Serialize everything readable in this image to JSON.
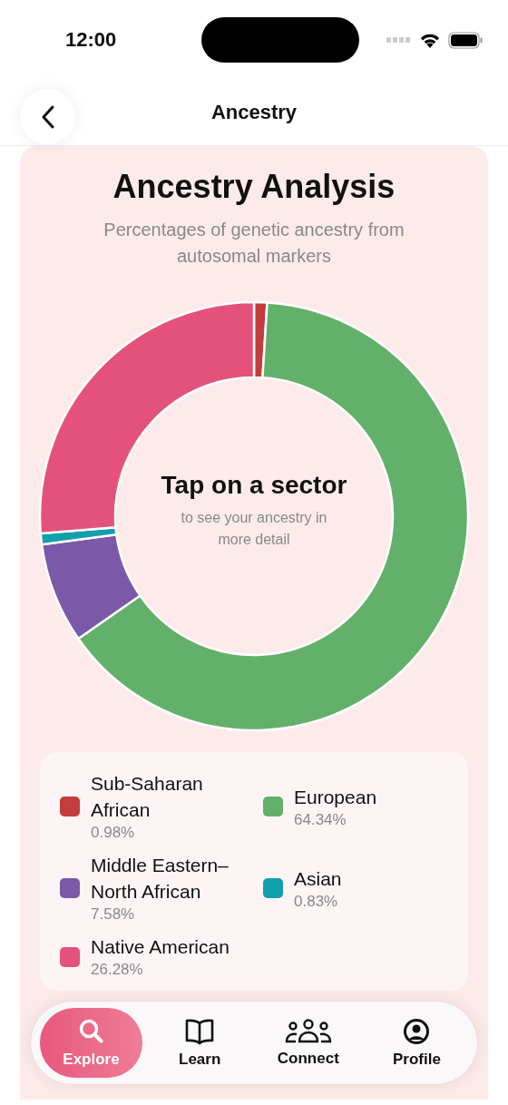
{
  "status_bar": {
    "time": "12:00"
  },
  "header": {
    "title": "Ancestry"
  },
  "card": {
    "title": "Ancestry Analysis",
    "subtitle": "Percentages of genetic ancestry from autosomal markers",
    "center_title": "Tap on a sector",
    "center_subtitle": "to see your ancestry in more detail",
    "chart_data": {
      "type": "donut",
      "categories": [
        "Sub-Saharan African",
        "European",
        "Middle Eastern–North African",
        "Asian",
        "Native American"
      ],
      "values": [
        0.98,
        64.34,
        7.58,
        0.83,
        26.28
      ]
    },
    "legend": [
      {
        "percent": "0.98%",
        "color": "#c43c3c"
      },
      {
        "percent": "64.34%",
        "color": "#62b06a"
      },
      {
        "percent": "7.58%",
        "color": "#7b59a8"
      },
      {
        "percent": "0.83%",
        "color": "#12a0ac"
      },
      {
        "percent": "26.28%",
        "color": "#e4527c"
      }
    ]
  },
  "tabs": [
    {
      "label": "Explore",
      "kind": "search",
      "selected": true
    },
    {
      "label": "Learn",
      "kind": "book",
      "selected": false
    },
    {
      "label": "Connect",
      "kind": "people",
      "selected": false
    },
    {
      "label": "Profile",
      "kind": "person",
      "selected": false
    }
  ]
}
